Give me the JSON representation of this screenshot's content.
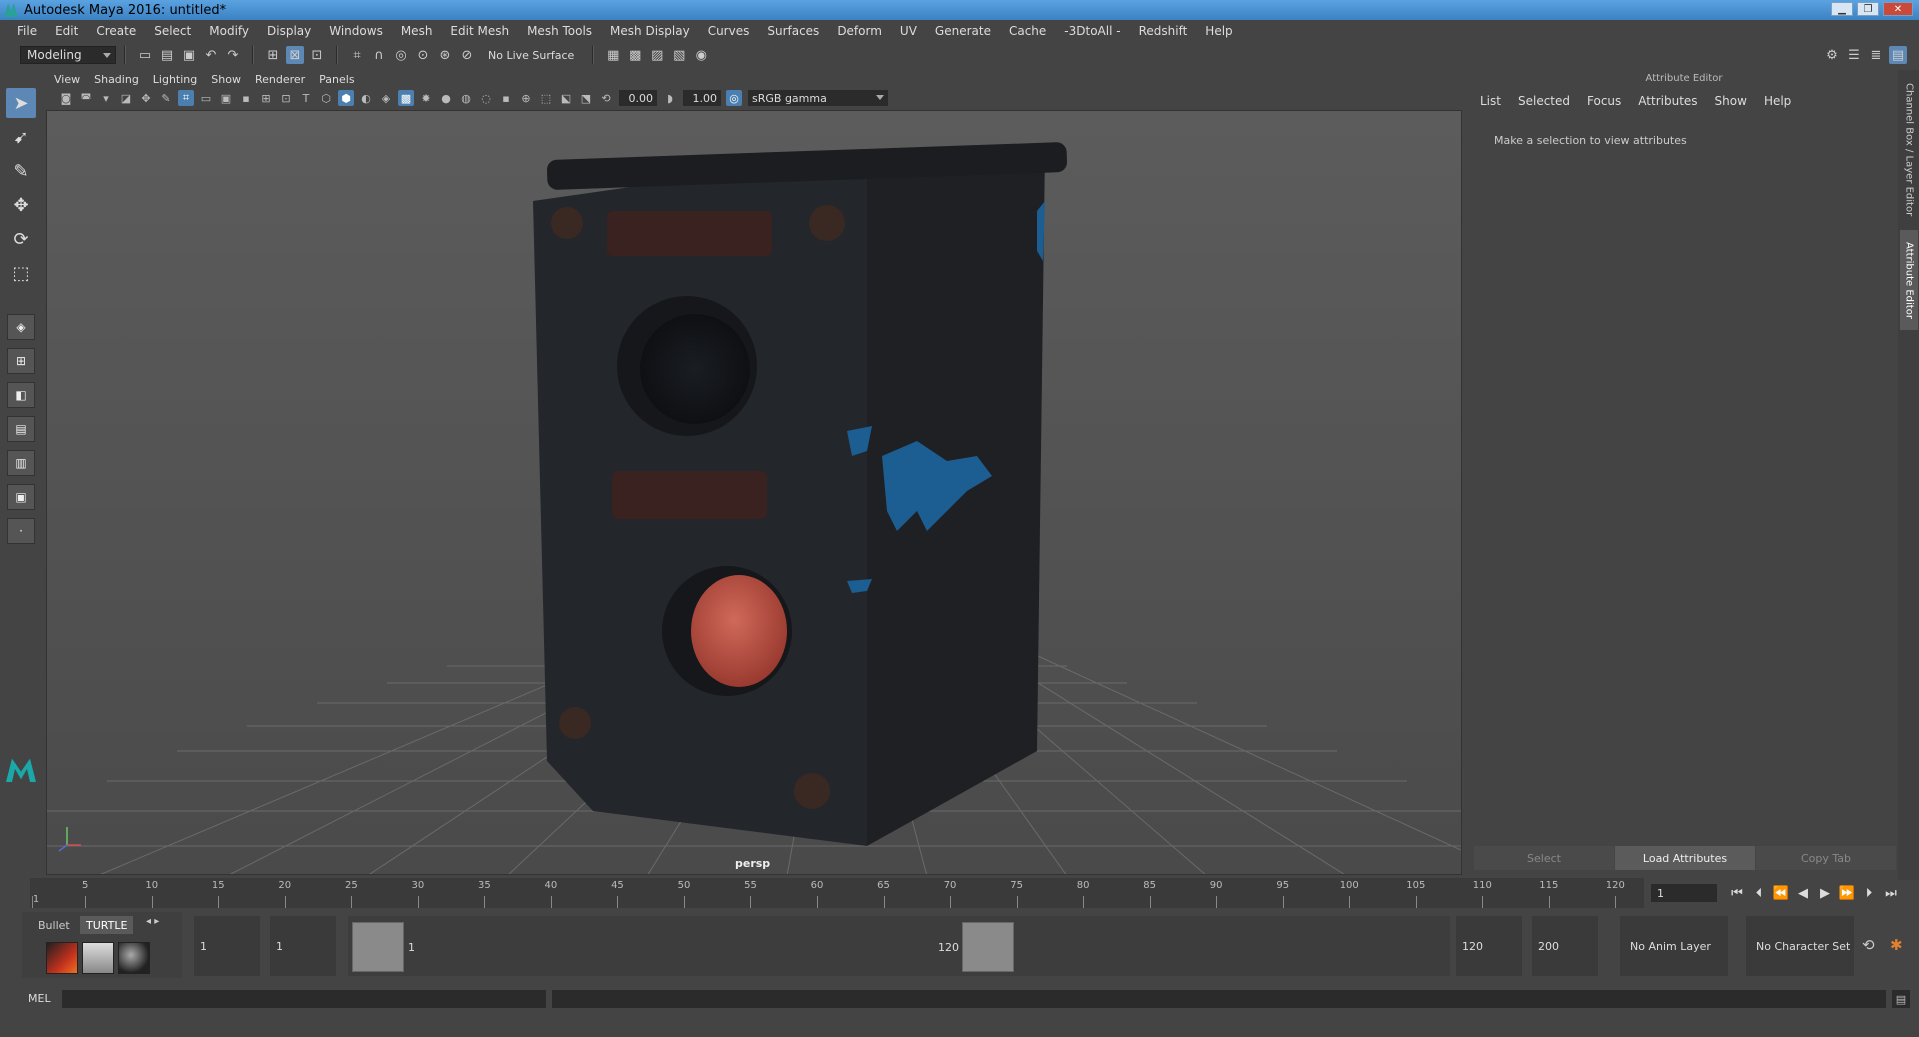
{
  "window": {
    "title": "Autodesk Maya 2016: untitled*"
  },
  "menubar": [
    "File",
    "Edit",
    "Create",
    "Select",
    "Modify",
    "Display",
    "Windows",
    "Mesh",
    "Edit Mesh",
    "Mesh Tools",
    "Mesh Display",
    "Curves",
    "Surfaces",
    "Deform",
    "UV",
    "Generate",
    "Cache",
    "-3DtoAll -",
    "Redshift",
    "Help"
  ],
  "statusline": {
    "mode": "Modeling",
    "live_surface": "No Live Surface"
  },
  "panel": {
    "menus": [
      "View",
      "Shading",
      "Lighting",
      "Show",
      "Renderer",
      "Panels"
    ],
    "exposure": "0.00",
    "gamma": "1.00",
    "color_space": "sRGB gamma",
    "camera_label": "persp"
  },
  "attribute_editor": {
    "title": "Attribute Editor",
    "menus": [
      "List",
      "Selected",
      "Focus",
      "Attributes",
      "Show",
      "Help"
    ],
    "message": "Make a selection to view attributes",
    "buttons": [
      "Select",
      "Load Attributes",
      "Copy Tab"
    ]
  },
  "side_tabs": [
    "Channel Box / Layer Editor",
    "Attribute Editor"
  ],
  "timeline": {
    "ticks": [
      1,
      5,
      10,
      15,
      20,
      25,
      30,
      35,
      40,
      45,
      50,
      55,
      60,
      65,
      70,
      75,
      80,
      85,
      90,
      95,
      100,
      105,
      110,
      115,
      120
    ],
    "current_frame": "1"
  },
  "shelf": {
    "tabs": [
      "Bullet",
      "TURTLE"
    ]
  },
  "range": {
    "start_time": "1",
    "playback_start": "1",
    "range_start_label": "1",
    "range_end_label": "120",
    "playback_end": "120",
    "end_time": "200",
    "anim_layer": "No Anim Layer",
    "character_set": "No Character Set"
  },
  "command_line": {
    "label": "MEL"
  }
}
